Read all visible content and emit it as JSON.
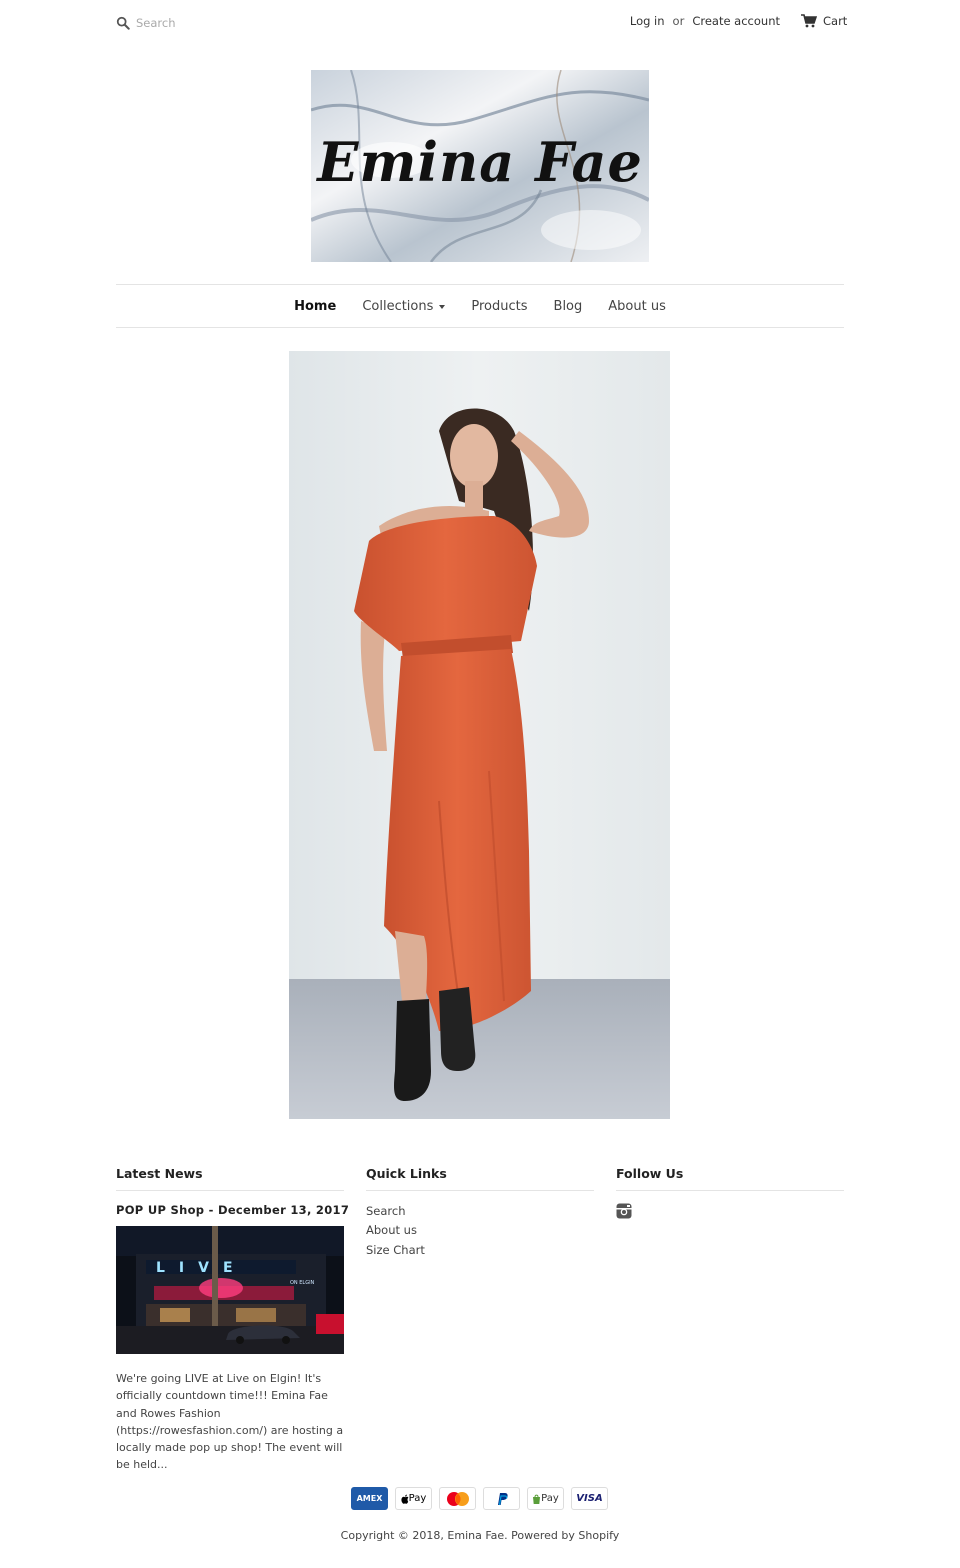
{
  "header": {
    "search_placeholder": "Search",
    "login": "Log in",
    "or": "or",
    "create_account": "Create account",
    "cart": "Cart"
  },
  "logo": {
    "text": "Emina Fae"
  },
  "nav": {
    "items": [
      {
        "label": "Home",
        "active": true
      },
      {
        "label": "Collections",
        "dropdown": true
      },
      {
        "label": "Products"
      },
      {
        "label": "Blog"
      },
      {
        "label": "About us"
      }
    ]
  },
  "footer": {
    "latest_news": {
      "title": "Latest News",
      "post_title": "POP UP Shop - December 13, 2017",
      "excerpt": "We're going LIVE at Live on Elgin! It's officially countdown time!!! Emina Fae and Rowes Fashion (https://rowesfashion.com/) are hosting a locally made pop up shop! The event will be held...",
      "image_sign_text": "LIVE",
      "image_sub_sign": "ON ELGIN"
    },
    "quick_links": {
      "title": "Quick Links",
      "links": [
        "Search",
        "About us",
        "Size Chart"
      ]
    },
    "follow_us": {
      "title": "Follow Us",
      "icons": [
        "instagram-icon"
      ]
    },
    "payments": [
      "AMEX",
      "Apple Pay",
      "Mastercard",
      "PayPal",
      "Shopify Pay",
      "VISA"
    ],
    "payment_labels": {
      "amex": "AMEX",
      "apple": "Pay",
      "shop": "Pay",
      "visa": "VISA"
    },
    "copyright": "Copyright © 2018, Emina Fae. Powered by Shopify"
  },
  "colors": {
    "dress": "#e0633f",
    "text": "#333333",
    "rule": "#e4e4e4"
  }
}
